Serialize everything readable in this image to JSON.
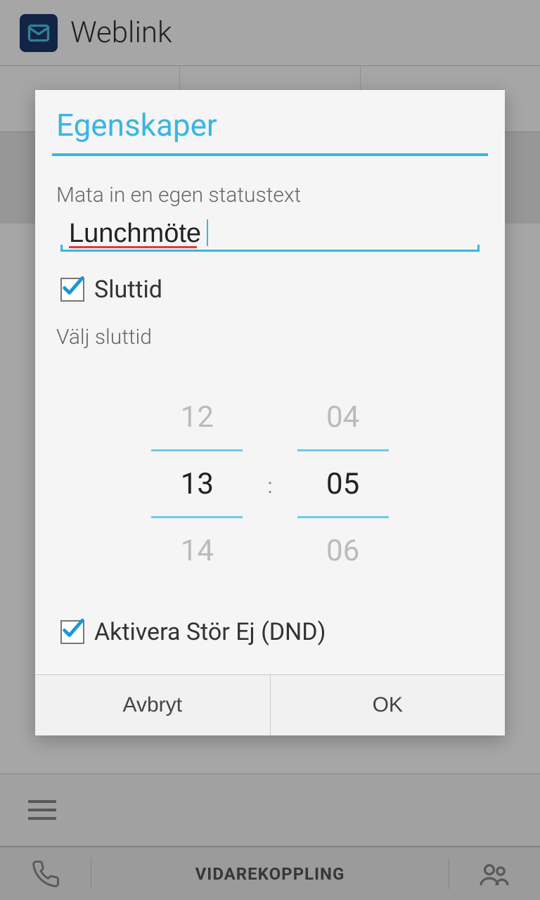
{
  "header": {
    "app_name": "Weblink"
  },
  "bottom_bar": {
    "center_label": "VIDAREKOPPLING"
  },
  "modal": {
    "title": "Egenskaper",
    "statustext_label": "Mata in en egen statustext",
    "statustext_value": "Lunchmöte",
    "endtime_checkbox_label": "Sluttid",
    "endtime_checked": true,
    "endtime_section_label": "Välj sluttid",
    "time_picker": {
      "hours": {
        "prev": "12",
        "current": "13",
        "next": "14"
      },
      "minutes": {
        "prev": "04",
        "current": "05",
        "next": "06"
      },
      "separator": ":"
    },
    "dnd_checkbox_label": "Aktivera Stör Ej (DND)",
    "dnd_checked": true,
    "cancel_label": "Avbryt",
    "ok_label": "OK"
  }
}
